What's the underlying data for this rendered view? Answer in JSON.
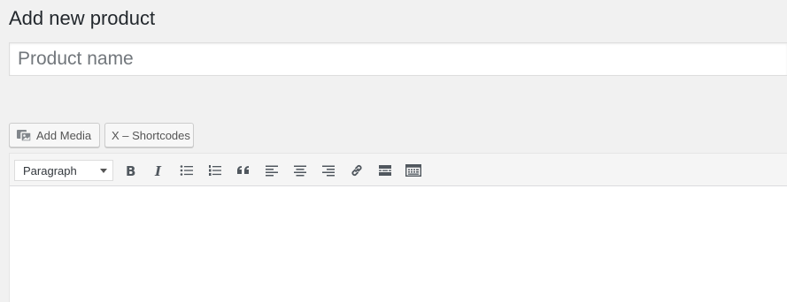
{
  "page": {
    "title": "Add new product"
  },
  "title_field": {
    "placeholder": "Product name",
    "value": ""
  },
  "media_buttons": {
    "add_media_label": "Add Media",
    "shortcodes_label": "X – Shortcodes"
  },
  "toolbar": {
    "format_selected": "Paragraph",
    "buttons": [
      {
        "name": "bold-icon",
        "title": "Bold"
      },
      {
        "name": "italic-icon",
        "title": "Italic"
      },
      {
        "name": "bulleted-list-icon",
        "title": "Bulleted list"
      },
      {
        "name": "numbered-list-icon",
        "title": "Numbered list"
      },
      {
        "name": "blockquote-icon",
        "title": "Blockquote"
      },
      {
        "name": "align-left-icon",
        "title": "Align left"
      },
      {
        "name": "align-center-icon",
        "title": "Align center"
      },
      {
        "name": "align-right-icon",
        "title": "Align right"
      },
      {
        "name": "insert-link-icon",
        "title": "Insert/edit link"
      },
      {
        "name": "read-more-icon",
        "title": "Insert Read More tag"
      },
      {
        "name": "toolbar-toggle-icon",
        "title": "Toolbar Toggle"
      }
    ]
  },
  "editor": {
    "content": ""
  },
  "colors": {
    "background": "#f1f1f1",
    "icon": "#50575e",
    "border": "#dddddd"
  }
}
